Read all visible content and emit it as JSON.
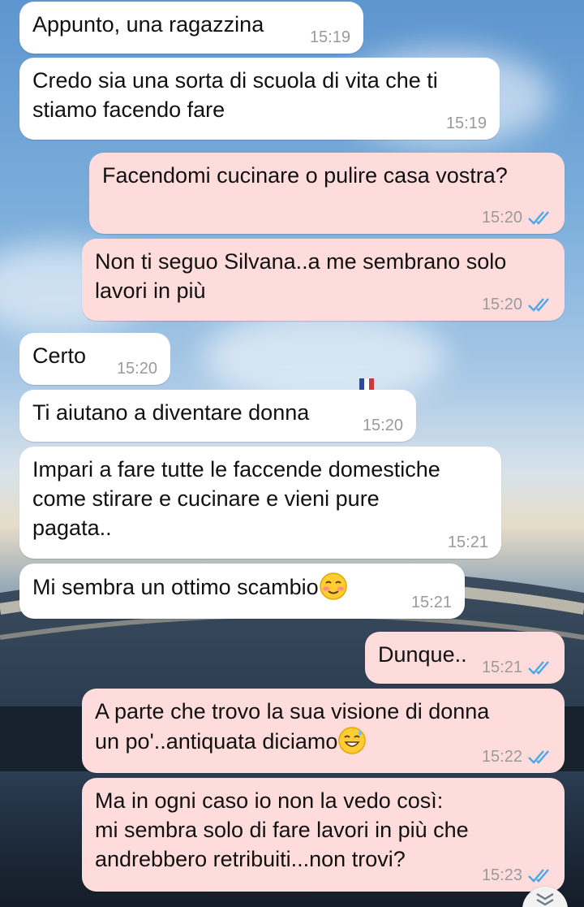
{
  "colors": {
    "incoming_bubble": "#ffffff",
    "outgoing_bubble": "#ffdcdc",
    "timestamp": "#9a9a9a",
    "read_ticks": "#4aa6e8"
  },
  "messages": [
    {
      "direction": "in",
      "text": "Appunto, una ragazzina",
      "time": "15:19"
    },
    {
      "direction": "in",
      "text": "Credo sia una sorta di scuola di vita che ti\nstiamo facendo fare",
      "time": "15:19"
    },
    {
      "direction": "out",
      "text": "Facendomi cucinare o pulire casa vostra?",
      "time": "15:20",
      "status": "read-ticks-icon"
    },
    {
      "direction": "out",
      "text": "Non ti seguo Silvana..a me sembrano solo\nlavori in più",
      "time": "15:20",
      "status": "read-ticks-icon"
    },
    {
      "direction": "in",
      "text": "Certo",
      "time": "15:20"
    },
    {
      "direction": "in",
      "text": "Ti aiutano a diventare donna",
      "time": "15:20"
    },
    {
      "direction": "in",
      "text": "Impari a fare tutte le faccende domestiche\ncome stirare e cucinare e vieni pure\npagata..",
      "time": "15:21"
    },
    {
      "direction": "in",
      "text": "Mi sembra un ottimo scambio",
      "emoji": "smiling-face-icon",
      "time": "15:21"
    },
    {
      "direction": "out",
      "text": "Dunque..",
      "time": "15:21",
      "status": "read-ticks-icon"
    },
    {
      "direction": "out",
      "text": "A parte che trovo la sua visione di donna\nun po'..antiquata diciamo",
      "emoji": "grinning-sweat-face-icon",
      "time": "15:22",
      "status": "read-ticks-icon"
    },
    {
      "direction": "out",
      "text": "Ma in ogni caso io non la vedo così:\nmi sembra solo di fare lavori in più che\nandrebbero retribuiti...non trovi?",
      "time": "15:23",
      "status": "read-ticks-icon"
    }
  ],
  "scroll_button": {
    "icon": "double-chevron-down-icon"
  }
}
